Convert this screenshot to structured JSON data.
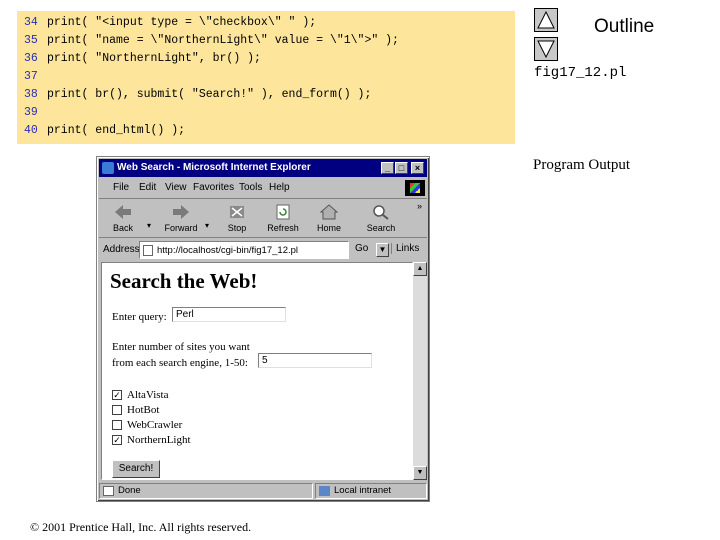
{
  "code": {
    "lines": [
      {
        "num": "34",
        "text": "print( \"<input type = \\\"checkbox\\\" \" );"
      },
      {
        "num": "35",
        "text": "print( \"name = \\\"NorthernLight\\\" value = \\\"1\\\">\" );"
      },
      {
        "num": "36",
        "text": "print( \"NorthernLight\", br() );"
      },
      {
        "num": "37",
        "text": ""
      },
      {
        "num": "38",
        "text": "print( br(), submit( \"Search!\" ), end_form() );"
      },
      {
        "num": "39",
        "text": ""
      },
      {
        "num": "40",
        "text": "print( end_html() );"
      }
    ]
  },
  "outline": {
    "title": "Outline",
    "figure": "fig17_12.pl",
    "program_output": "Program Output",
    "colors": {
      "panel": "#fde59c",
      "line_numbers": "#2b2bb8"
    }
  },
  "browser": {
    "title": "Web Search - Microsoft Internet Explorer",
    "window_buttons": {
      "minimize": "_",
      "maximize": "□",
      "close": "×"
    },
    "menu": [
      "File",
      "Edit",
      "View",
      "Favorites",
      "Tools",
      "Help"
    ],
    "toolbar": [
      {
        "label": "Back",
        "icon": "back-arrow-icon"
      },
      {
        "label": "Forward",
        "icon": "forward-arrow-icon"
      },
      {
        "label": "Stop",
        "icon": "stop-icon"
      },
      {
        "label": "Refresh",
        "icon": "refresh-icon"
      },
      {
        "label": "Home",
        "icon": "home-icon"
      },
      {
        "label": "Search",
        "icon": "search-icon"
      }
    ],
    "address": {
      "label": "Address",
      "value": "http://localhost/cgi-bin/fig17_12.pl",
      "go": "Go",
      "links": "Links"
    },
    "page": {
      "heading": "Search the Web!",
      "query_label": "Enter query:",
      "query_value": "Perl",
      "count_label_1": "Enter number of sites you want",
      "count_label_2": "from each search engine, 1-50:",
      "count_value": "5",
      "engines": [
        {
          "name": "AltaVista",
          "checked": true
        },
        {
          "name": "HotBot",
          "checked": false
        },
        {
          "name": "WebCrawler",
          "checked": false
        },
        {
          "name": "NorthernLight",
          "checked": true
        }
      ],
      "submit_label": "Search!"
    },
    "status": {
      "left": "Done",
      "right": "Local intranet"
    }
  },
  "footer": {
    "copyright": "© 2001 Prentice Hall, Inc.  All rights reserved."
  }
}
